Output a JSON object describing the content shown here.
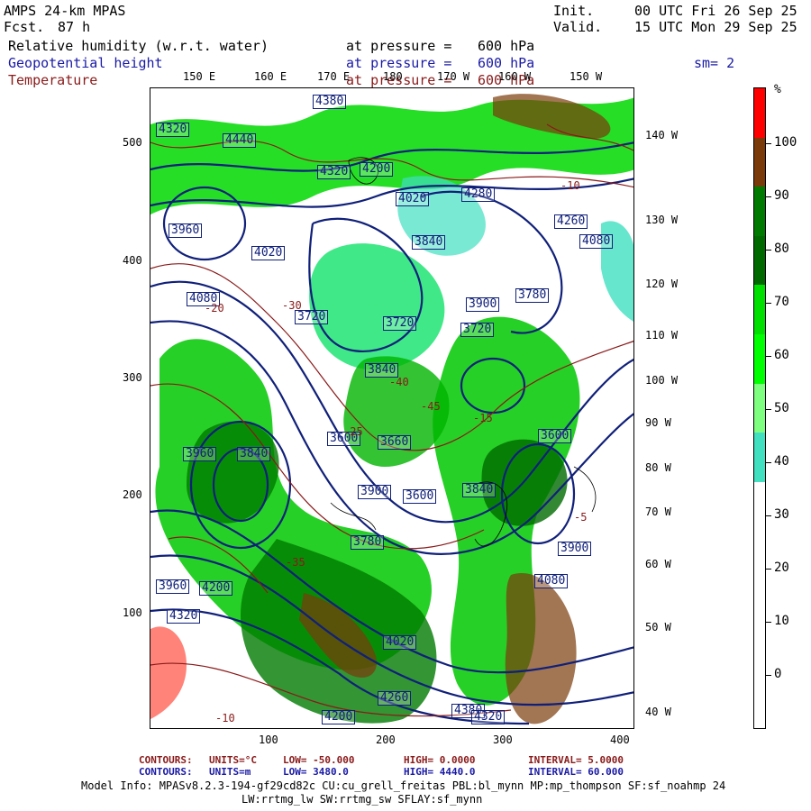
{
  "header": {
    "title": "AMPS 24-km MPAS",
    "fcst_label": "Fcst.",
    "fcst_value": "87 h",
    "init_label": "Init.",
    "init_value": "00 UTC Fri 26 Sep 25",
    "valid_label": "Valid.",
    "valid_value": "15 UTC Mon 29 Sep 25",
    "fields": [
      {
        "name": "Relative humidity (w.r.t. water)",
        "pressure_label": "at pressure =",
        "pressure": "600 hPa"
      },
      {
        "name": "Geopotential height",
        "pressure_label": "at pressure =",
        "pressure": "600 hPa"
      },
      {
        "name": "Temperature",
        "pressure_label": "at pressure =",
        "pressure": "600 hPa"
      }
    ],
    "smoothing": "sm= 2"
  },
  "axes": {
    "x_ticks": [
      "100",
      "200",
      "300",
      "400"
    ],
    "y_ticks": [
      "500",
      "400",
      "300",
      "200",
      "100"
    ],
    "top_lon_labels": [
      "150 E",
      "160 E",
      "170 E",
      "180",
      "170 W",
      "160 W",
      "150 W"
    ],
    "right_lon_labels": [
      "140 W",
      "130 W",
      "120 W",
      "110 W",
      "100 W",
      "90 W",
      "80 W",
      "70 W",
      "60 W",
      "50 W",
      "40 W"
    ]
  },
  "colorbar": {
    "unit": "%",
    "labels": [
      "100",
      "90",
      "80",
      "70",
      "60",
      "50",
      "40",
      "30",
      "20",
      "10",
      "0"
    ],
    "colors": [
      "#ff0000",
      "#7a3a0a",
      "#007a00",
      "#006a00",
      "#00e000",
      "#00ff00",
      "#7fff7f",
      "#40e0c0",
      "#ffffff",
      "#ffffff",
      "#ffffff",
      "#ffffff",
      "#ffffff"
    ]
  },
  "contour_labels": {
    "height": [
      "4380",
      "4320",
      "4440",
      "4320",
      "4200",
      "4280",
      "4080",
      "4020",
      "3840",
      "3960",
      "4020",
      "4260",
      "4080",
      "3720",
      "3720",
      "3900",
      "3780",
      "3720",
      "3840",
      "3600",
      "3600",
      "3960",
      "3840",
      "3660",
      "3900",
      "3600",
      "3840",
      "3780",
      "3900",
      "4080",
      "3960",
      "4200",
      "4020",
      "4260",
      "4380",
      "4200",
      "4320",
      "4320"
    ],
    "temperature": [
      "-10",
      "-10",
      "-20",
      "-30",
      "-40",
      "-45",
      "-25",
      "-15",
      "-5",
      "-35"
    ]
  },
  "footer": {
    "temp_contours": {
      "label": "CONTOURS:",
      "units": "UNITS=°C",
      "low": "LOW= -50.000",
      "high": "HIGH= 0.0000",
      "interval": "INTERVAL= 5.0000"
    },
    "height_contours": {
      "label": "CONTOURS:",
      "units": "UNITS=m",
      "low": "LOW= 3480.0",
      "high": "HIGH= 4440.0",
      "interval": "INTERVAL= 60.000"
    },
    "model_info_1": "Model Info: MPASv8.2.3-194-gf29cd82c CU:cu_grell_freitas PBL:bl_mynn MP:mp_thompson SF:sf_noahmp 24",
    "model_info_2": "LW:rrtmg_lw SW:rrtmg_sw SFLAY:sf_mynn"
  }
}
